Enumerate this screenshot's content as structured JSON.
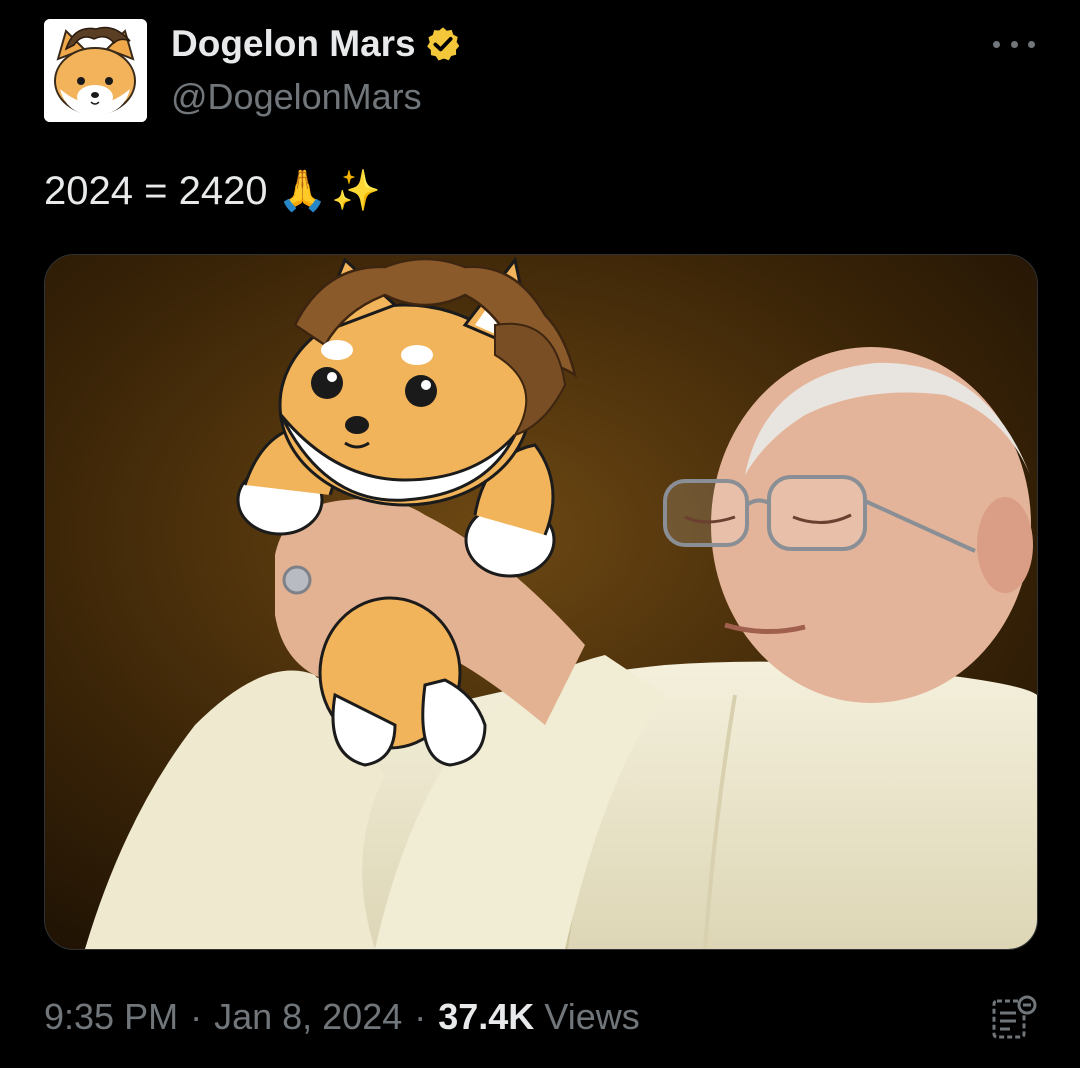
{
  "author": {
    "display_name": "Dogelon Mars",
    "handle": "@DogelonMars",
    "verified_icon": "verified-badge-icon",
    "verified_color": "#f4c73a"
  },
  "tweet": {
    "text": "2024 = 2420",
    "emojis": [
      "🙏",
      "✨"
    ]
  },
  "media": {
    "description_icon": "photo"
  },
  "meta": {
    "time": "9:35 PM",
    "separator": "·",
    "date": "Jan 8, 2024",
    "views_count": "37.4K",
    "views_label": "Views"
  },
  "colors": {
    "background": "#000000",
    "primary_text": "#e7e9ea",
    "secondary_text": "#71767b"
  }
}
